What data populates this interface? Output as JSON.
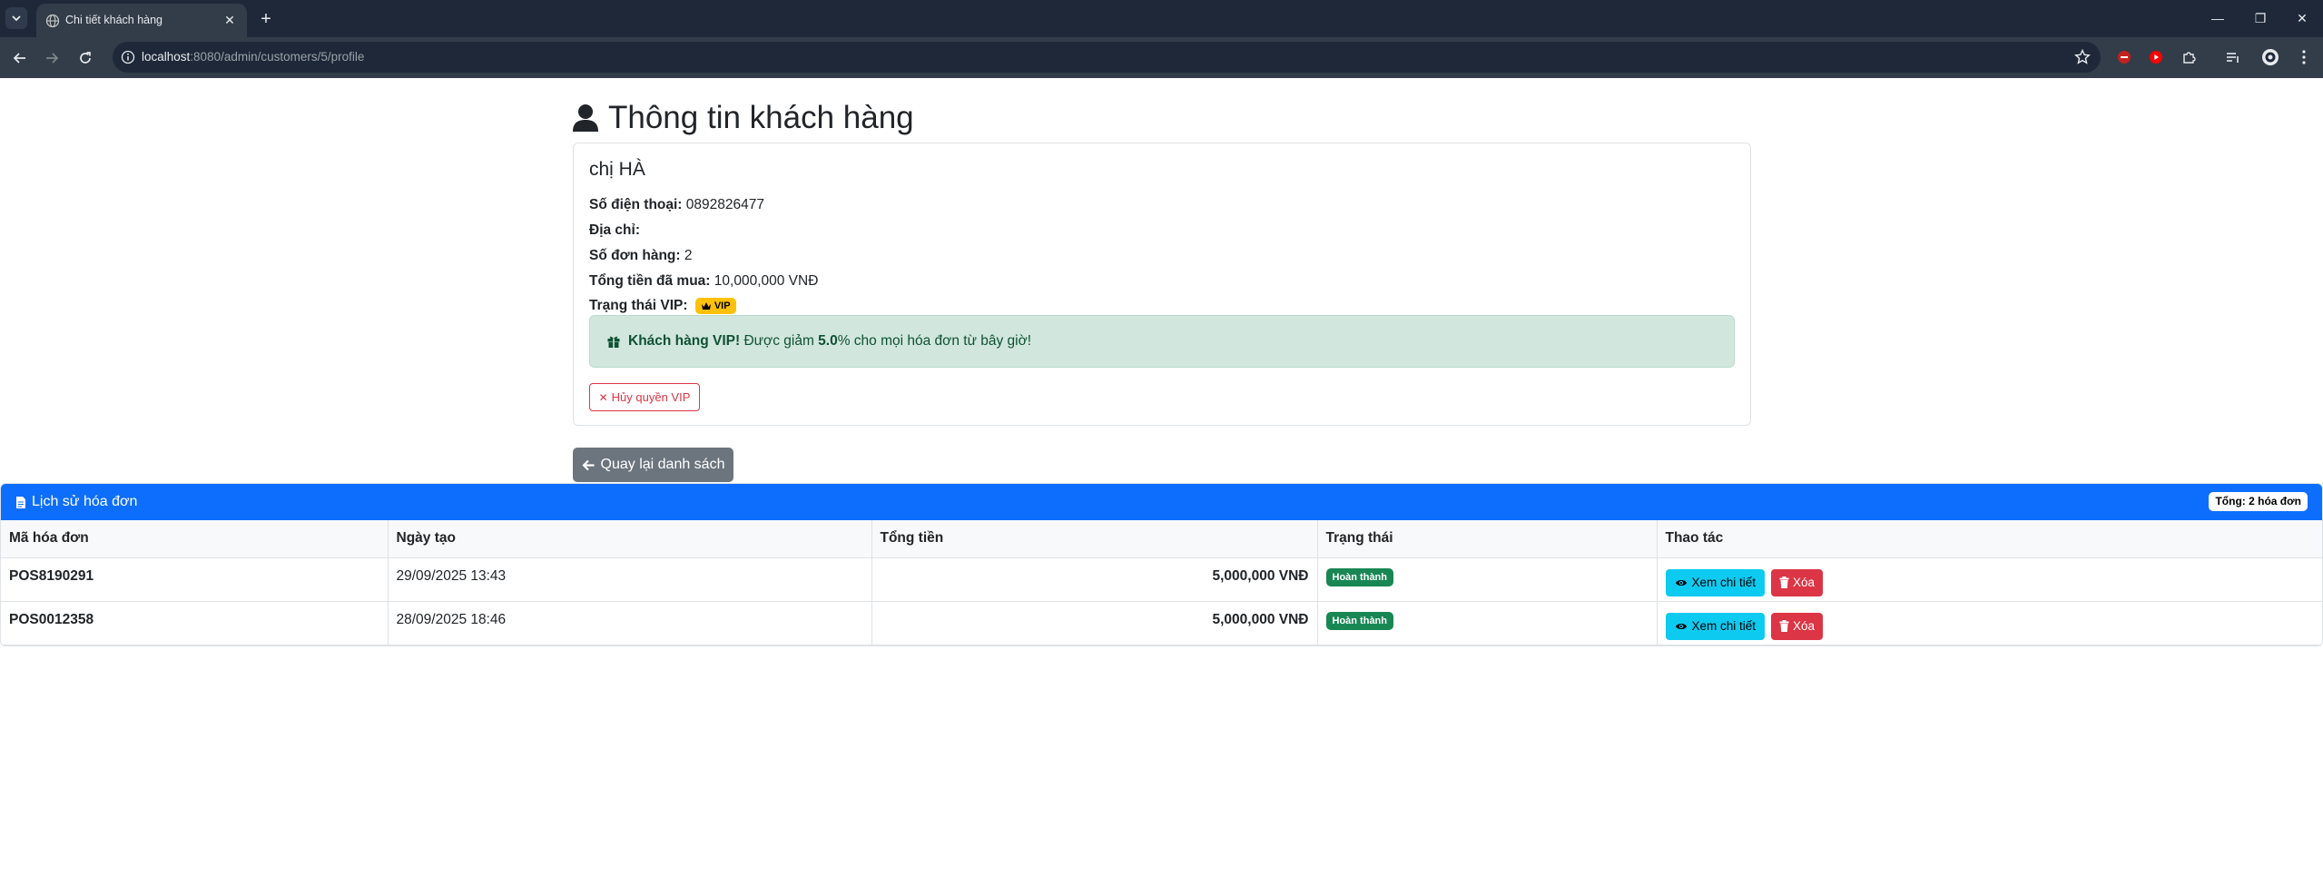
{
  "browser": {
    "tab_title": "Chi tiết khách hàng",
    "url_host": "localhost",
    "url_path": ":8080/admin/customers/5/profile",
    "icons": {
      "tab_menu": "chevron-down-icon",
      "favicon": "globe-icon",
      "close": "close-icon",
      "new_tab": "plus-icon",
      "back": "arrow-left-icon",
      "forward": "arrow-right-icon",
      "reload": "reload-icon",
      "info": "info-icon",
      "bookmark": "star-icon"
    }
  },
  "page": {
    "title": "Thông tin khách hàng",
    "title_icon": "user-icon"
  },
  "customer": {
    "name": "chị HÀ",
    "phone_label": "Số điện thoại:",
    "phone": "0892826477",
    "address_label": "Địa chỉ:",
    "address": "",
    "orders_label": "Số đơn hàng:",
    "orders": "2",
    "total_label": "Tổng tiền đã mua:",
    "total": "10,000,000 VNĐ",
    "vip_label": "Trạng thái VIP:",
    "vip_badge": "VIP",
    "vip_badge_icon": "crown-icon"
  },
  "vip_alert": {
    "icon": "gift-icon",
    "strong": "Khách hàng VIP!",
    "text_before": " Được giảm ",
    "discount": "5.0",
    "text_after": "% cho mọi hóa đơn từ bây giờ!",
    "bg_color": "#d1e7dd"
  },
  "revoke_button": {
    "label": "Hủy quyền VIP",
    "icon": "x-icon"
  },
  "back_button": {
    "label": "Quay lại danh sách",
    "icon": "arrow-left-icon"
  },
  "history": {
    "title": "Lịch sử hóa đơn",
    "title_icon": "document-icon",
    "count_badge": "Tổng: 2 hóa đơn",
    "header_color": "#0d6efd",
    "columns": [
      "Mã hóa đơn",
      "Ngày tạo",
      "Tổng tiền",
      "Trạng thái",
      "Thao tác"
    ],
    "rows": [
      {
        "code": "POS8190291",
        "date": "29/09/2025 13:43",
        "total": "5,000,000 VNĐ",
        "status": "Hoàn thành",
        "view": "Xem chi tiết",
        "delete": "Xóa"
      },
      {
        "code": "POS0012358",
        "date": "28/09/2025 18:46",
        "total": "5,000,000 VNĐ",
        "status": "Hoàn thành",
        "view": "Xem chi tiết",
        "delete": "Xóa"
      }
    ]
  },
  "colors": {
    "primary": "#0d6efd",
    "success": "#198754",
    "danger": "#dc3545",
    "info": "#0dcaf0",
    "warning": "#ffc107",
    "secondary": "#6c757d"
  }
}
